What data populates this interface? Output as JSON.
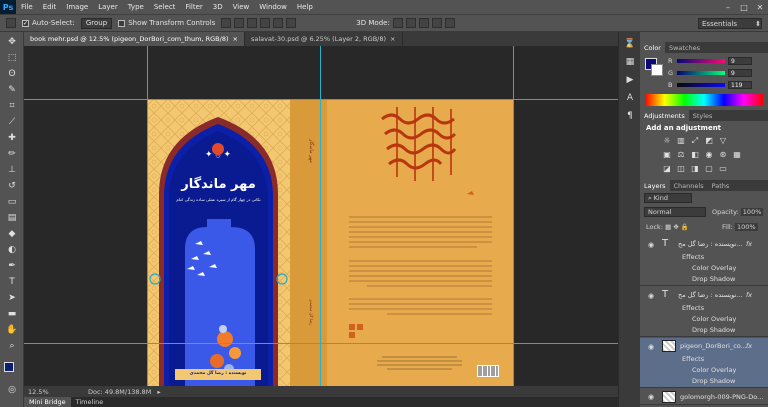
{
  "app": {
    "logo": "Ps",
    "menu": [
      "File",
      "Edit",
      "Image",
      "Layer",
      "Type",
      "Select",
      "Filter",
      "3D",
      "View",
      "Window",
      "Help"
    ]
  },
  "options_bar": {
    "auto_select_label": "Auto-Select:",
    "auto_select_value": "Group",
    "show_transform_label": "Show Transform Controls",
    "mode_label": "3D Mode:",
    "workspace": "Essentials"
  },
  "tabs": [
    {
      "label": "book mehr.psd @ 12.5% (pigeon_DorBori_com_thum, RGB/8)"
    },
    {
      "label": "salavat-30.psd @ 6.25% (Layer 2, RGB/8)"
    }
  ],
  "status": {
    "zoom": "12.5%",
    "doc": "Doc: 49.8M/138.8M"
  },
  "bottom_tabs": [
    "Mini Bridge",
    "Timeline"
  ],
  "color_panel": {
    "tabs": [
      "Color",
      "Swatches"
    ],
    "r": "9",
    "g": "9",
    "b": "119"
  },
  "adjustments_panel": {
    "tabs": [
      "Adjustments",
      "Styles"
    ],
    "title": "Add an adjustment"
  },
  "layers_panel": {
    "tabs": [
      "Layers",
      "Channels",
      "Paths"
    ],
    "filter": "Kind",
    "blend_mode": "Normal",
    "opacity_label": "Opacity:",
    "opacity": "100%",
    "lock_label": "Lock:",
    "fill_label": "Fill:",
    "fill": "100%",
    "layers": [
      {
        "type": "text",
        "name": "نویسنده : رضا گل مح...",
        "effects": [
          "Effects",
          "Color Overlay",
          "Drop Shadow"
        ]
      },
      {
        "type": "text",
        "name": "نویسنده : رضا گل مح...",
        "effects": [
          "Effects",
          "Color Overlay",
          "Drop Shadow"
        ]
      },
      {
        "type": "image",
        "name": "pigeon_DorBori_co...",
        "effects": [
          "Effects",
          "Color Overlay",
          "Drop Shadow"
        ]
      },
      {
        "type": "image",
        "name": "golomorgh-009-PNG-Do..."
      }
    ]
  },
  "cover": {
    "front_title": "مهر ماندگار",
    "front_subtitle": "نکاتی در چهار گام از سیره عملی ساده زندگی امام",
    "front_author": "نویسنده : رضا گل محمدی"
  },
  "colors": {
    "ui_dark": "#282828",
    "ui_panel": "#535353",
    "guide": "#27b0c9",
    "cover_navy": "#0a1f9e",
    "cover_gold": "#e7ab4e",
    "foreground": "#090977"
  }
}
